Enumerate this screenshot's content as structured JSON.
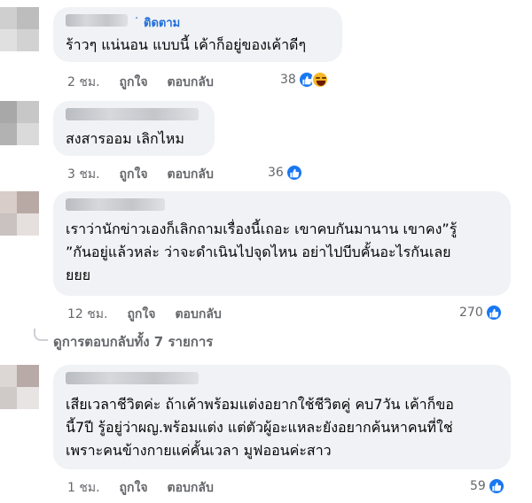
{
  "comments": [
    {
      "follow_label": "ติดตาม",
      "text_lines": [
        "ร้าวๆ แน่นอน แบบนี้ เค้าก็อยู่ของเค้าดีๆ"
      ],
      "time": "2 ชม.",
      "like_label": "ถูกใจ",
      "reply_label": "ตอบกลับ",
      "reaction_count": "38",
      "reactions": [
        "like-icon",
        "haha-icon"
      ]
    },
    {
      "text_lines": [
        "สงสารออม เลิกไหม"
      ],
      "time": "3 ชม.",
      "like_label": "ถูกใจ",
      "reply_label": "ตอบกลับ",
      "reaction_count": "36",
      "reactions": [
        "like-icon"
      ]
    },
    {
      "text_lines": [
        "เราว่านักข่าวเองก็เลิกถามเรื่องนี้เถอะ เขาคบกันมานาน เขาคง”รู้",
        "”กันอยู่แล้วหล่ะ ว่าจะดำเนินไปจุดไหน อย่าไปบีบคั้นอะไรกันเลย",
        "ยยย"
      ],
      "time": "12 ชม.",
      "like_label": "ถูกใจ",
      "reply_label": "ตอบกลับ",
      "reaction_count": "270",
      "reactions": [
        "like-icon"
      ]
    },
    {
      "text_lines": [
        "เสียเวลาชีวิตค่ะ ถ้าเค้าพร้อมแต่งอยากใช้ชีวิตคู่ คบ7วัน เค้าก็ขอ",
        "นี้7ปี รู้อยู่ว่าผญ.พร้อมแต่ง แต่ตัวผู้อะแหละยังอยากค้นหาคนที่ใช่",
        "เพราะคนข้างกายแค่คั้นเวลา มูฟออนค่ะสาว"
      ],
      "time": "1 ชม.",
      "like_label": "ถูกใจ",
      "reply_label": "ตอบกลับ",
      "reaction_count": "59",
      "reactions": [
        "like-icon"
      ]
    }
  ],
  "view_replies_label": "ดูการตอบกลับทั้ง 7 รายการ",
  "colors": {
    "bubble": "#f0f2f5",
    "link": "#216fdb",
    "secondary_text": "#65676b",
    "like_blue": "#1877f2"
  }
}
